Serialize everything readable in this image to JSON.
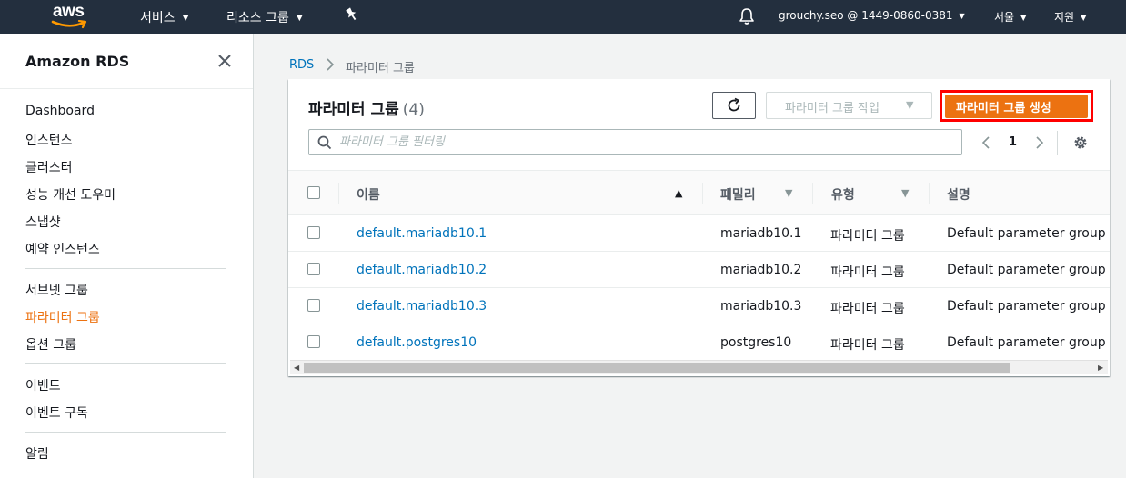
{
  "topnav": {
    "logo_text": "aws",
    "services": "서비스",
    "resource_groups": "리소스 그룹",
    "account": "grouchy.seo @ 1449-0860-0381",
    "region": "서울",
    "support": "지원"
  },
  "sidebar": {
    "title": "Amazon RDS",
    "group1": [
      "Dashboard",
      "인스턴스",
      "클러스터",
      "성능 개선 도우미",
      "스냅샷",
      "예약 인스턴스"
    ],
    "group2": [
      "서브넷 그룹",
      "파라미터 그룹",
      "옵션 그룹"
    ],
    "group3": [
      "이벤트",
      "이벤트 구독"
    ],
    "group4": [
      "알림"
    ],
    "active_item": "파라미터 그룹",
    "active_color": "#ec7211"
  },
  "breadcrumb": {
    "root": "RDS",
    "current": "파라미터 그룹"
  },
  "panel": {
    "title": "파라미터 그룹",
    "count": "(4)",
    "actions_label": "파라미터 그룹 작업",
    "create_label": "파라미터 그룹 생성",
    "search_placeholder": "파라미터 그룹 필터링",
    "page": "1"
  },
  "table": {
    "columns": [
      "이름",
      "패밀리",
      "유형",
      "설명"
    ],
    "rows": [
      {
        "name": "default.mariadb10.1",
        "family": "mariadb10.1",
        "type": "파라미터 그룹",
        "desc": "Default parameter group for"
      },
      {
        "name": "default.mariadb10.2",
        "family": "mariadb10.2",
        "type": "파라미터 그룹",
        "desc": "Default parameter group for"
      },
      {
        "name": "default.mariadb10.3",
        "family": "mariadb10.3",
        "type": "파라미터 그룹",
        "desc": "Default parameter group for"
      },
      {
        "name": "default.postgres10",
        "family": "postgres10",
        "type": "파라미터 그룹",
        "desc": "Default parameter group for"
      }
    ]
  },
  "colors": {
    "nav_bg": "#232f3e",
    "link": "#0073bb",
    "primary": "#ec7211",
    "highlight": "#ff0000"
  }
}
